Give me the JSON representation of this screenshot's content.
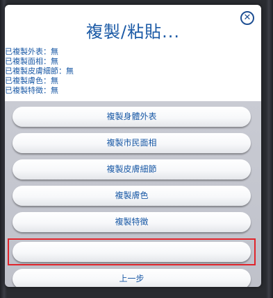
{
  "dialog": {
    "title": "複製/粘貼...",
    "close_label": "✕"
  },
  "status": {
    "lines": [
      "已複製外表：無",
      "已複製面相：無",
      "已複製皮膚細節：無",
      "已複製膚色：無",
      "已複製特徵：無"
    ]
  },
  "options": {
    "copy_body_appearance": "複製身體外表",
    "copy_townie_face": "複製市民面相",
    "copy_skin_details": "複製皮膚細節",
    "copy_skin_tone": "複製膚色",
    "copy_traits": "複製特徵",
    "blank_option": "",
    "back": "上一步"
  },
  "colors": {
    "accent": "#1b5aa6",
    "highlight": "#e0242b",
    "panel": "#c9cbd3"
  }
}
